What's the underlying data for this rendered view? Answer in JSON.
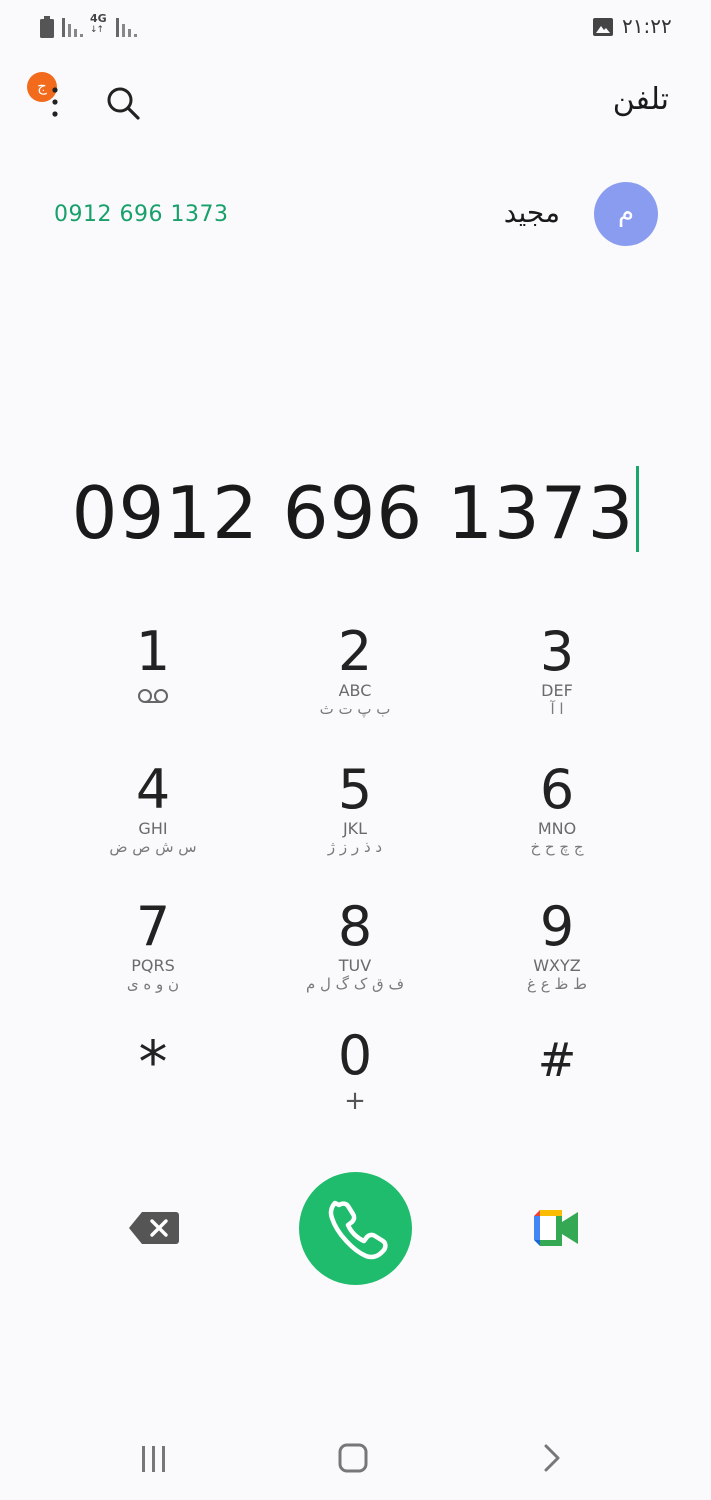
{
  "status_bar": {
    "network": "4G",
    "time": "۲۱:۲۲"
  },
  "header": {
    "title": "تلفن",
    "notification_badge": "ج"
  },
  "suggested_contact": {
    "avatar_letter": "م",
    "name": "مجید",
    "number": "0912 696 1373",
    "avatar_color": "#8a9cf0"
  },
  "dialer": {
    "number": "0912 696 1373"
  },
  "keypad": {
    "k1": {
      "digit": "1"
    },
    "k2": {
      "digit": "2",
      "latin": "ABC",
      "farsi": "ب پ ت ث"
    },
    "k3": {
      "digit": "3",
      "latin": "DEF",
      "farsi": "ا آ"
    },
    "k4": {
      "digit": "4",
      "latin": "GHI",
      "farsi": "س ش ص ض"
    },
    "k5": {
      "digit": "5",
      "latin": "JKL",
      "farsi": "د ذ ر ز ژ"
    },
    "k6": {
      "digit": "6",
      "latin": "MNO",
      "farsi": "ج چ ح خ"
    },
    "k7": {
      "digit": "7",
      "latin": "PQRS",
      "farsi": "ن و ه ی"
    },
    "k8": {
      "digit": "8",
      "latin": "TUV",
      "farsi": "ف ق ک گ ل م"
    },
    "k9": {
      "digit": "9",
      "latin": "WXYZ",
      "farsi": "ط ظ ع غ"
    },
    "kstar": {
      "digit": "*"
    },
    "k0": {
      "digit": "0",
      "sub": "+"
    },
    "khash": {
      "digit": "#"
    }
  },
  "colors": {
    "accent": "#18a06a",
    "call_button": "#20bc6e",
    "badge": "#f26b1d"
  }
}
